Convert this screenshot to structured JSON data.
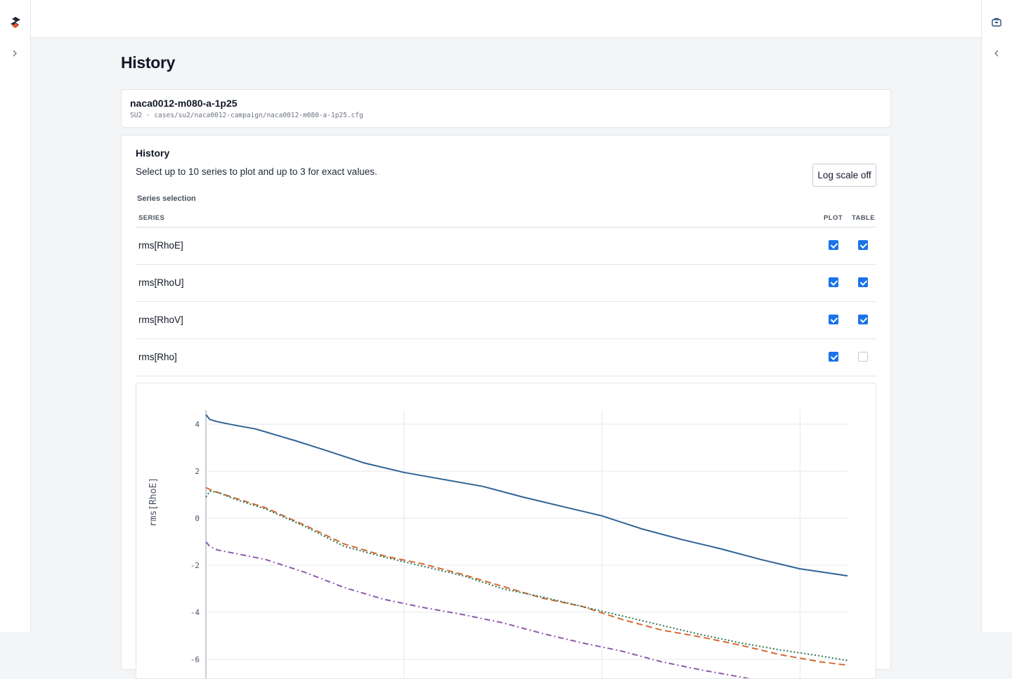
{
  "nav": {
    "expand_icon": "chevron-right-icon",
    "collapse_icon": "chevron-left-icon",
    "tool_icon": "toolbox-icon"
  },
  "page": {
    "title": "History"
  },
  "case": {
    "name": "naca0012-m080-a-1p25",
    "meta": "SU2 · cases/su2/naca0012-campaign/naca0012-m080-a-1p25.cfg"
  },
  "history": {
    "title": "History",
    "description": "Select up to 10 series to plot and up to 3 for exact values.",
    "log_scale_label": "Log scale off",
    "section_label": "Series selection",
    "columns": {
      "series": "SERIES",
      "plot": "PLOT",
      "table": "TABLE"
    },
    "rows": [
      {
        "name": "rms[RhoE]",
        "plot": true,
        "table": true
      },
      {
        "name": "rms[RhoU]",
        "plot": true,
        "table": true
      },
      {
        "name": "rms[RhoV]",
        "plot": true,
        "table": true
      },
      {
        "name": "rms[Rho]",
        "plot": true,
        "table": false
      }
    ]
  },
  "colors": {
    "accent": "#1a73e8",
    "rhoe": "#2e6395",
    "rhou": "#d46a35",
    "rhov": "#2f7552",
    "rho": "#8b59a8"
  },
  "chart_data": {
    "type": "line",
    "ylabel": "rms[RhoE]",
    "log_scale": false,
    "ylim": [
      -8,
      4.6
    ],
    "xlim": [
      0,
      3240
    ],
    "yticks": [
      4,
      2,
      0,
      -2,
      -4,
      -6
    ],
    "x_gridlines": [
      0,
      1000,
      2000,
      3000
    ],
    "grid": true,
    "series": [
      {
        "key": "rhoe",
        "style": "solid",
        "x": [
          0,
          20,
          60,
          150,
          250,
          350,
          450,
          600,
          800,
          1000,
          1200,
          1400,
          1600,
          1800,
          2000,
          2200,
          2400,
          2600,
          2800,
          3000,
          3200,
          3240
        ],
        "y": [
          4.4,
          4.2,
          4.1,
          3.95,
          3.8,
          3.55,
          3.3,
          2.9,
          2.35,
          1.95,
          1.65,
          1.35,
          0.9,
          0.5,
          0.1,
          -0.45,
          -0.9,
          -1.3,
          -1.75,
          -2.15,
          -2.4,
          -2.45
        ]
      },
      {
        "key": "rhou",
        "style": "dashed",
        "x": [
          0,
          40,
          150,
          300,
          500,
          700,
          900,
          1100,
          1300,
          1500,
          1700,
          1900,
          2100,
          2300,
          2500,
          2700,
          2900,
          3100,
          3240
        ],
        "y": [
          1.3,
          1.15,
          0.85,
          0.45,
          -0.3,
          -1.1,
          -1.6,
          -1.95,
          -2.4,
          -2.9,
          -3.4,
          -3.75,
          -4.3,
          -4.75,
          -5.05,
          -5.4,
          -5.8,
          -6.1,
          -6.25
        ]
      },
      {
        "key": "rhov",
        "style": "dotted",
        "x": [
          0,
          20,
          60,
          150,
          300,
          500,
          700,
          900,
          1100,
          1300,
          1500,
          1700,
          1900,
          2100,
          2300,
          2500,
          2700,
          2900,
          3100,
          3240
        ],
        "y": [
          0.9,
          1.15,
          1.1,
          0.8,
          0.4,
          -0.35,
          -1.2,
          -1.65,
          -2.05,
          -2.45,
          -3.0,
          -3.35,
          -3.75,
          -4.15,
          -4.55,
          -4.95,
          -5.3,
          -5.6,
          -5.85,
          -6.05
        ]
      },
      {
        "key": "rho",
        "style": "dashdot",
        "x": [
          0,
          20,
          60,
          150,
          300,
          500,
          700,
          900,
          1100,
          1300,
          1500,
          1700,
          1900,
          2100,
          2300,
          2500,
          2700,
          2900,
          3100,
          3240
        ],
        "y": [
          -1.0,
          -1.2,
          -1.35,
          -1.5,
          -1.75,
          -2.3,
          -2.95,
          -3.45,
          -3.8,
          -4.1,
          -4.45,
          -4.9,
          -5.3,
          -5.65,
          -6.1,
          -6.45,
          -6.75,
          -7.1,
          -7.45,
          -7.65
        ]
      }
    ]
  }
}
